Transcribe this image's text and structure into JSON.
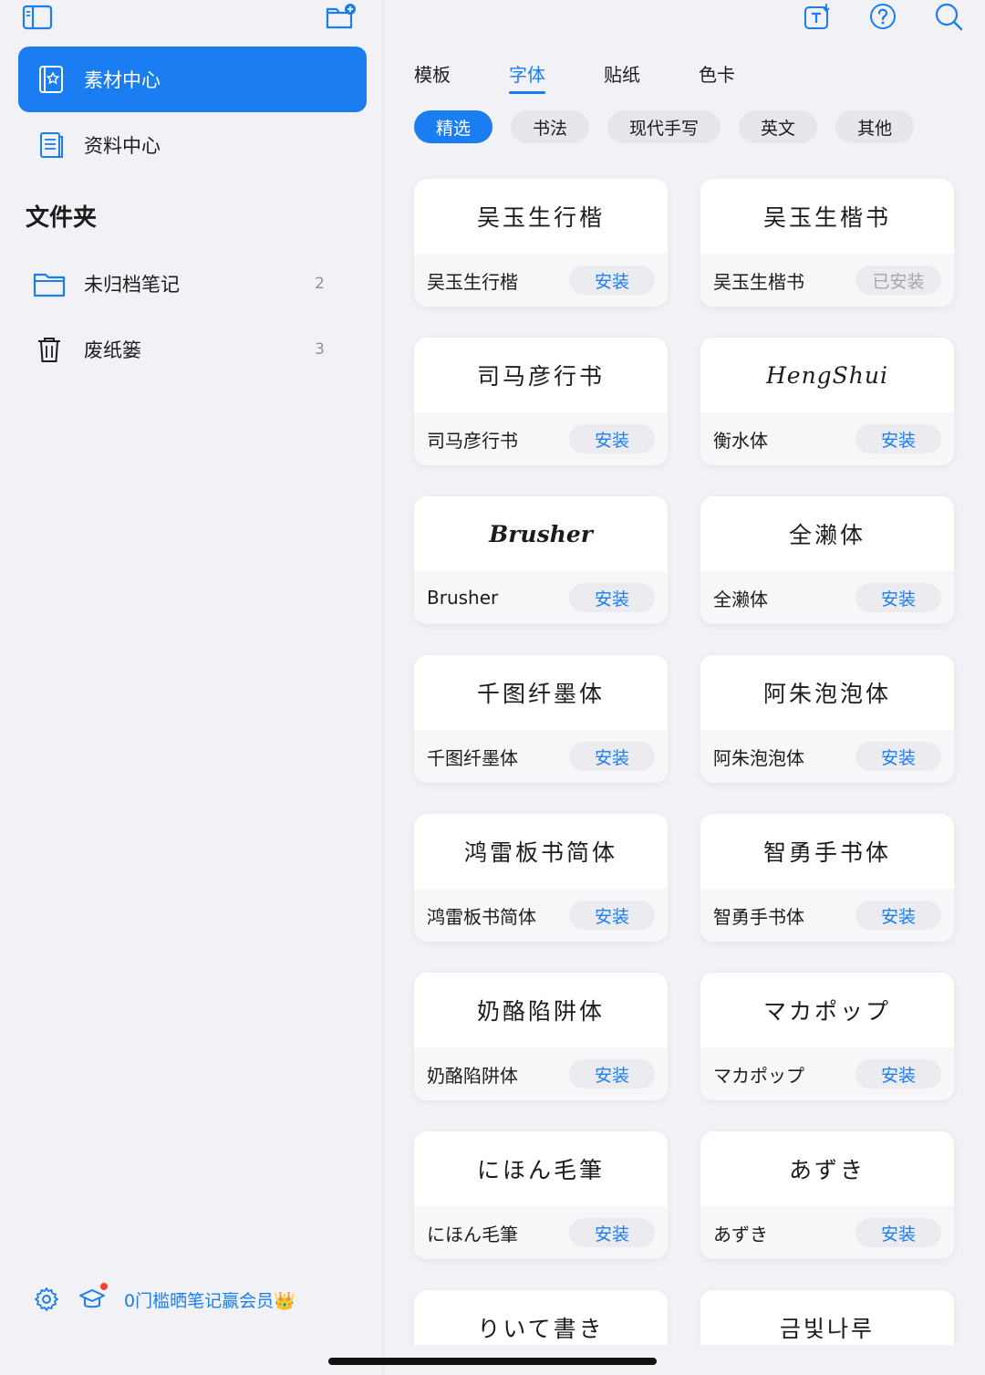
{
  "sidebar": {
    "nav": [
      {
        "label": "素材中心",
        "icon": "material-center-icon",
        "active": true
      },
      {
        "label": "资料中心",
        "icon": "document-center-icon",
        "active": false
      }
    ],
    "folders_heading": "文件夹",
    "folders": [
      {
        "label": "未归档笔记",
        "count": "2",
        "icon": "folder-icon"
      },
      {
        "label": "废纸篓",
        "count": "3",
        "icon": "trash-icon"
      }
    ],
    "promo": "0门槛晒笔记赢会员👑"
  },
  "main": {
    "tabs": [
      {
        "label": "模板",
        "active": false
      },
      {
        "label": "字体",
        "active": true
      },
      {
        "label": "贴纸",
        "active": false
      },
      {
        "label": "色卡",
        "active": false
      }
    ],
    "chips": [
      {
        "label": "精选",
        "active": true
      },
      {
        "label": "书法",
        "active": false
      },
      {
        "label": "现代手写",
        "active": false
      },
      {
        "label": "英文",
        "active": false
      },
      {
        "label": "其他",
        "active": false
      }
    ],
    "fonts": [
      {
        "preview": "吴玉生行楷",
        "name": "吴玉生行楷",
        "action": "安装",
        "installed": false,
        "style": ""
      },
      {
        "preview": "吴玉生楷书",
        "name": "吴玉生楷书",
        "action": "已安装",
        "installed": true,
        "style": ""
      },
      {
        "preview": "司马彦行书",
        "name": "司马彦行书",
        "action": "安装",
        "installed": false,
        "style": ""
      },
      {
        "preview": "HengShui",
        "name": "衡水体",
        "action": "安装",
        "installed": false,
        "style": "italic"
      },
      {
        "preview": "Brusher",
        "name": "Brusher",
        "action": "安装",
        "installed": false,
        "style": "bold"
      },
      {
        "preview": "全濑体",
        "name": "全濑体",
        "action": "安装",
        "installed": false,
        "style": ""
      },
      {
        "preview": "千图纤墨体",
        "name": "千图纤墨体",
        "action": "安装",
        "installed": false,
        "style": ""
      },
      {
        "preview": "阿朱泡泡体",
        "name": "阿朱泡泡体",
        "action": "安装",
        "installed": false,
        "style": ""
      },
      {
        "preview": "鸿雷板书简体",
        "name": "鸿雷板书简体",
        "action": "安装",
        "installed": false,
        "style": ""
      },
      {
        "preview": "智勇手书体",
        "name": "智勇手书体",
        "action": "安装",
        "installed": false,
        "style": ""
      },
      {
        "preview": "奶酪陷阱体",
        "name": "奶酪陷阱体",
        "action": "安装",
        "installed": false,
        "style": ""
      },
      {
        "preview": "マカポップ",
        "name": "マカポップ",
        "action": "安装",
        "installed": false,
        "style": ""
      },
      {
        "preview": "にほん毛筆",
        "name": "にほん毛筆",
        "action": "安装",
        "installed": false,
        "style": ""
      },
      {
        "preview": "あずき",
        "name": "あずき",
        "action": "安装",
        "installed": false,
        "style": ""
      },
      {
        "preview": "りいて書き",
        "name": "",
        "action": "",
        "installed": false,
        "style": ""
      },
      {
        "preview": "금빛나루",
        "name": "",
        "action": "",
        "installed": false,
        "style": ""
      }
    ]
  },
  "colors": {
    "accent": "#1a7df1",
    "background": "#f2f2f6",
    "card": "#ffffff",
    "installed_text": "#a5a5aa",
    "badge": "#ff3b30"
  }
}
